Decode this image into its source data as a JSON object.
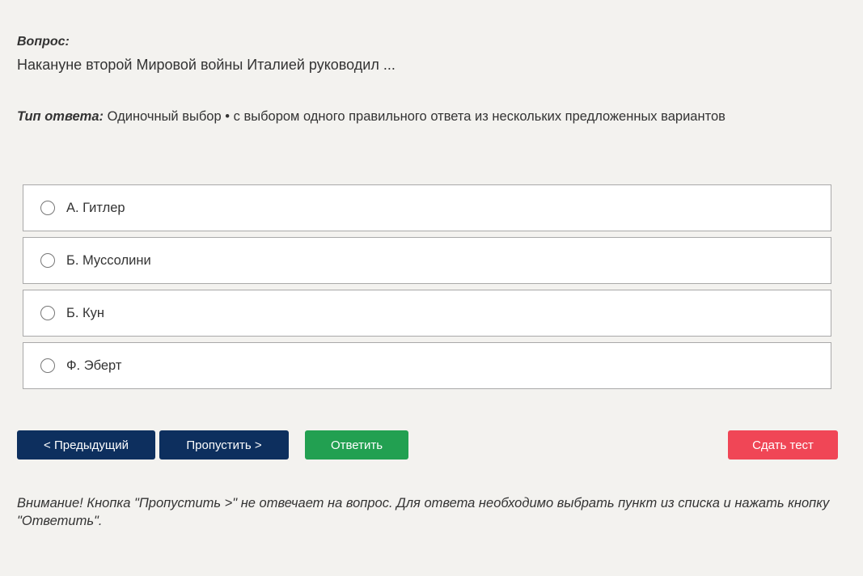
{
  "question": {
    "label": "Вопрос:",
    "text": "Накануне второй Мировой войны Италией руководил ..."
  },
  "answer_type": {
    "label": "Тип ответа:",
    "value": "Одиночный выбор • с выбором одного правильного ответа из нескольких предложенных вариантов"
  },
  "options": [
    {
      "label": "А. Гитлер",
      "selected": false
    },
    {
      "label": "Б. Муссолини",
      "selected": false
    },
    {
      "label": "Б. Кун",
      "selected": false
    },
    {
      "label": "Ф. Эберт",
      "selected": false
    }
  ],
  "buttons": {
    "prev_label": "< Предыдущий",
    "skip_label": "Пропустить >",
    "answer_label": "Ответить",
    "submit_label": "Сдать тест"
  },
  "notice": "Внимание! Кнопка \"Пропустить >\" не отвечает на вопрос. Для ответа необходимо выбрать пункт из списка и нажать кнопку \"Ответить\".",
  "colors": {
    "background": "#f3f2ef",
    "nav_button": "#0d2f5e",
    "answer_button": "#22a051",
    "submit_button": "#f04656"
  }
}
